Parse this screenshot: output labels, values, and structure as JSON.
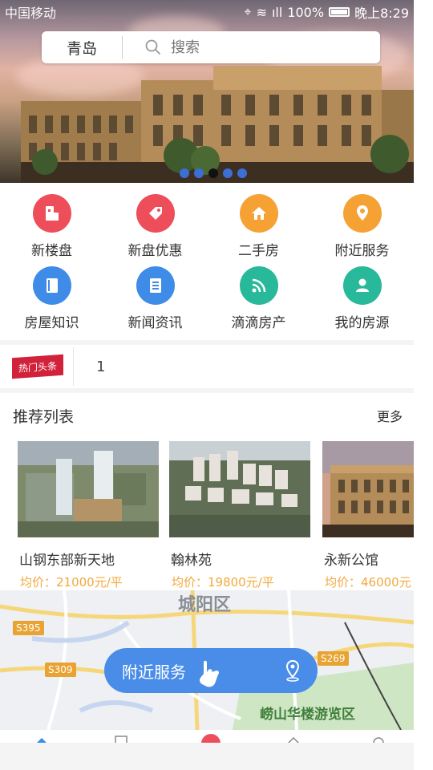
{
  "status_bar": {
    "carrier": "中国移动",
    "battery": "100%",
    "time": "晚上8:29"
  },
  "search": {
    "city": "青岛",
    "placeholder": "搜索"
  },
  "banner": {
    "slide_count": 5,
    "active_index": 2
  },
  "categories": [
    {
      "label": "新楼盘",
      "icon": "building-icon",
      "color": "#ee4d5a"
    },
    {
      "label": "新盘优惠",
      "icon": "tag-icon",
      "color": "#ee4d5a"
    },
    {
      "label": "二手房",
      "icon": "house-icon",
      "color": "#f5a133"
    },
    {
      "label": "附近服务",
      "icon": "location-pin-icon",
      "color": "#f5a133"
    },
    {
      "label": "房屋知识",
      "icon": "book-icon",
      "color": "#3f8ce8"
    },
    {
      "label": "新闻资讯",
      "icon": "news-icon",
      "color": "#3f8ce8"
    },
    {
      "label": "滴滴房产",
      "icon": "rss-icon",
      "color": "#28b89a"
    },
    {
      "label": "我的房源",
      "icon": "user-icon",
      "color": "#28b89a"
    }
  ],
  "hot_news": {
    "tag": "热门头条",
    "text": "1"
  },
  "recommend": {
    "title": "推荐列表",
    "more": "更多",
    "items": [
      {
        "name": "山钢东部新天地",
        "price": "均价：21000元/平"
      },
      {
        "name": "翰林苑",
        "price": "均价：19800元/平"
      },
      {
        "name": "永新公馆",
        "price": "均价：46000元"
      }
    ]
  },
  "map": {
    "district": "城阳区",
    "scenic": "崂山华楼游览区",
    "roads": [
      "S395",
      "S309",
      "S269"
    ],
    "nearby_button": "附近服务"
  },
  "colors": {
    "accent_blue": "#4a8de8",
    "price_orange": "#f2a93b",
    "hot_red": "#d2223b"
  }
}
